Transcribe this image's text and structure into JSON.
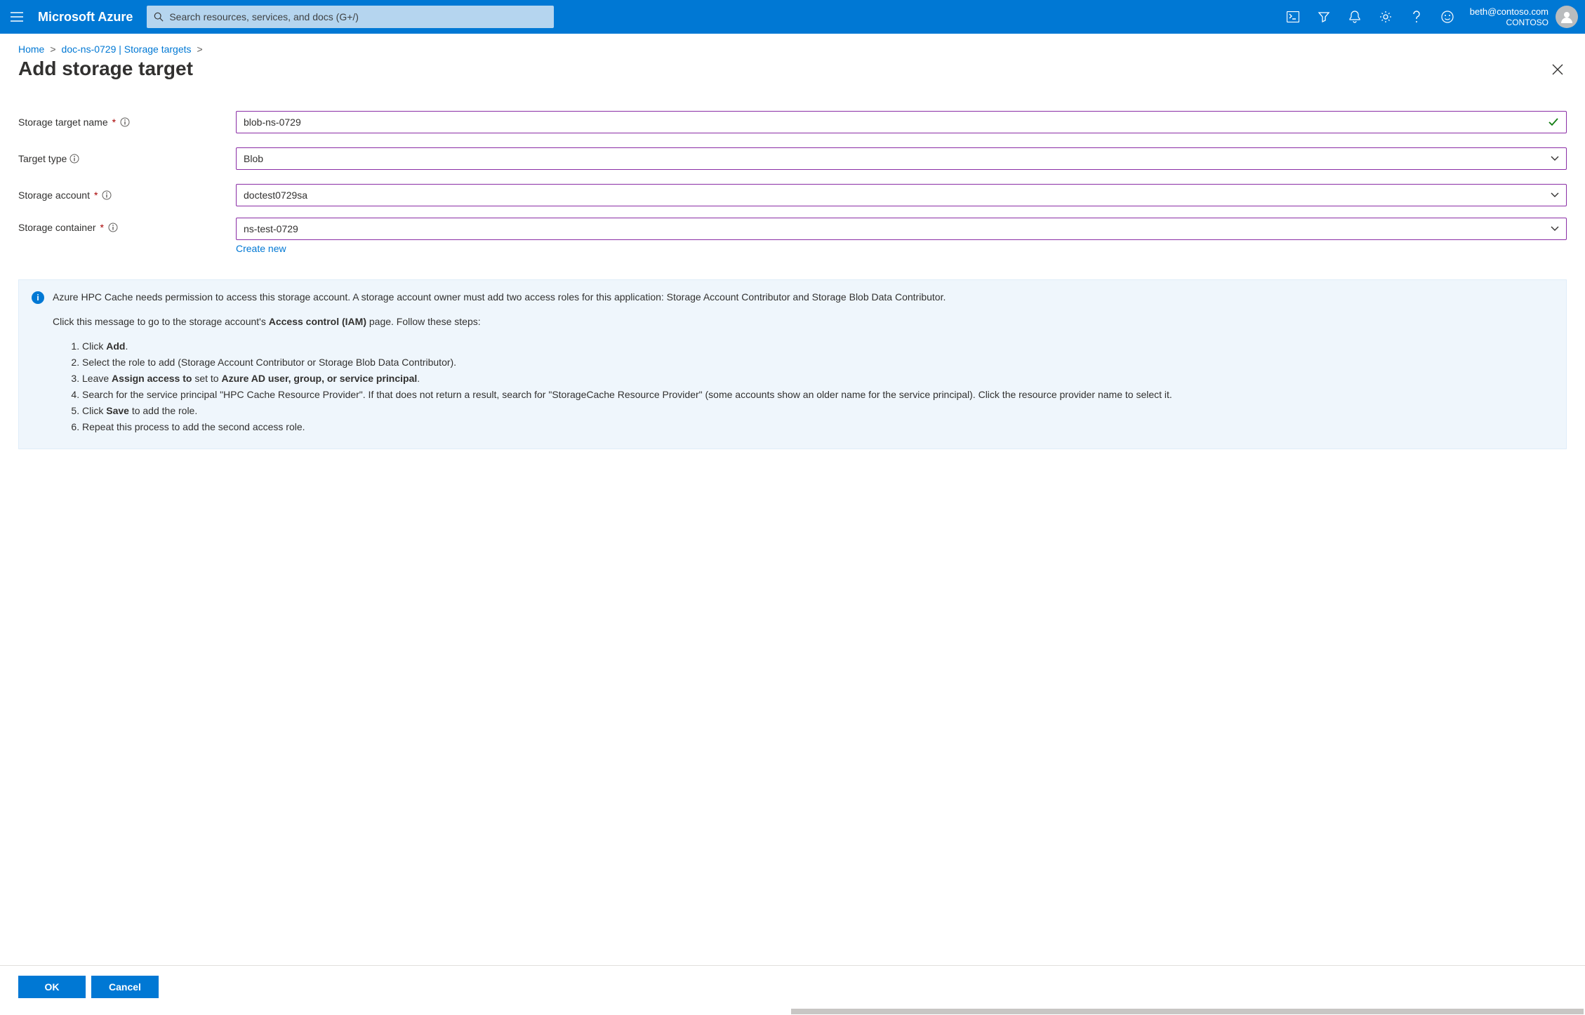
{
  "header": {
    "brand": "Microsoft Azure",
    "search_placeholder": "Search resources, services, and docs (G+/)",
    "account_email": "beth@contoso.com",
    "account_org": "CONTOSO"
  },
  "breadcrumb": {
    "home": "Home",
    "item2": "doc-ns-0729 | Storage targets"
  },
  "page": {
    "title": "Add storage target"
  },
  "form": {
    "storage_target_name": {
      "label": "Storage target name",
      "value": "blob-ns-0729"
    },
    "target_type": {
      "label": "Target type",
      "value": "Blob"
    },
    "storage_account": {
      "label": "Storage account",
      "value": "doctest0729sa"
    },
    "storage_container": {
      "label": "Storage container",
      "value": "ns-test-0729",
      "create_new": "Create new"
    }
  },
  "info": {
    "p1_a": "Azure HPC Cache needs permission to access this storage account. A storage account owner must add two access roles for this application: Storage Account Contributor and Storage Blob Data Contributor.",
    "p2_a": "Click this message to go to the storage account's ",
    "p2_b": "Access control (IAM)",
    "p2_c": " page. Follow these steps:",
    "steps": {
      "s1a": "Click ",
      "s1b": "Add",
      "s1c": ".",
      "s2": "Select the role to add (Storage Account Contributor or Storage Blob Data Contributor).",
      "s3a": "Leave ",
      "s3b": "Assign access to",
      "s3c": " set to ",
      "s3d": "Azure AD user, group, or service principal",
      "s3e": ".",
      "s4": "Search for the service principal \"HPC Cache Resource Provider\". If that does not return a result, search for \"StorageCache Resource Provider\" (some accounts show an older name for the service principal). Click the resource provider name to select it.",
      "s5a": "Click ",
      "s5b": "Save",
      "s5c": " to add the role.",
      "s6": "Repeat this process to add the second access role."
    }
  },
  "footer": {
    "ok": "OK",
    "cancel": "Cancel"
  }
}
